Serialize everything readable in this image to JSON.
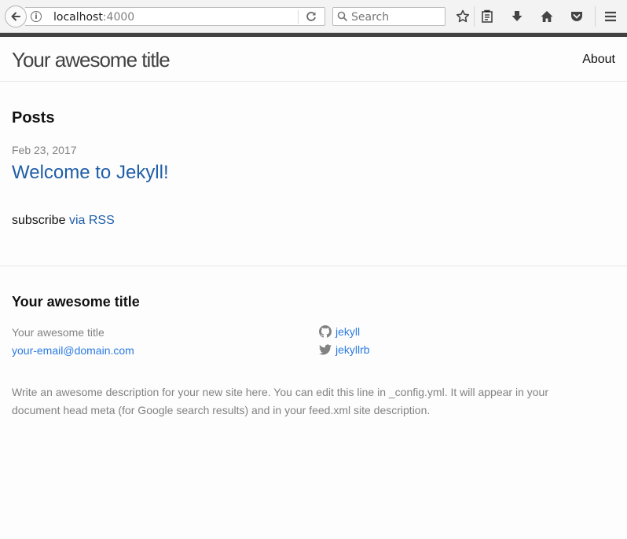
{
  "browser": {
    "url_host": "localhost",
    "url_port": ":4000",
    "search_placeholder": "Search"
  },
  "header": {
    "site_title": "Your awesome title",
    "nav": [
      {
        "label": "About"
      }
    ]
  },
  "main": {
    "heading": "Posts",
    "posts": [
      {
        "date": "Feb 23, 2017",
        "title": "Welcome to Jekyll!"
      }
    ],
    "subscribe_prefix": "subscribe",
    "subscribe_link": "via RSS"
  },
  "footer": {
    "heading": "Your awesome title",
    "name": "Your awesome title",
    "email": "your-email@domain.com",
    "github": {
      "icon": "github-icon",
      "label": "jekyll"
    },
    "twitter": {
      "icon": "twitter-icon",
      "label": "jekyllrb"
    },
    "description": "Write an awesome description for your new site here. You can edit this line in _config.yml. It will appear in your document head meta (for Google search results) and in your feed.xml site description."
  },
  "colors": {
    "link": "#2a7ae2",
    "muted": "#828282",
    "toolbar_dark": "#424242"
  }
}
